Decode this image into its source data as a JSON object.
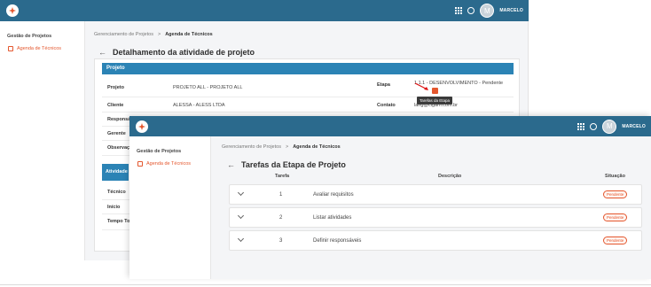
{
  "app": {
    "user_initial": "M",
    "user_name": "MARCELO",
    "brand_color": "#2b6a8d",
    "accent_color": "#e4572e"
  },
  "back": {
    "sidebar": {
      "title": "Gestão de Projetos",
      "item": "Agenda de Técnicos"
    },
    "breadcrumb": [
      "Gerenciamento de Projetos",
      ">",
      "Agenda de Técnicos"
    ],
    "page_title": "Detalhamento da atividade de projeto",
    "section": "Projeto",
    "section2": "Atividade",
    "rows": [
      {
        "label": "Projeto",
        "value": "PROJETO ALL - PROJETO ALL",
        "label2": "Etapa",
        "value2": "1.1.1 - DESENVOLVIMENTO - Pendente"
      },
      {
        "label": "Cliente",
        "value": "ALESSA - ALESS LTDA",
        "label2": "Contato",
        "value2": "lang@cigam.com.br"
      },
      {
        "label": "Responsável"
      },
      {
        "label": "Gerente"
      },
      {
        "label": "Observação"
      }
    ],
    "rows2": [
      {
        "label": "Técnico"
      },
      {
        "label": "Início"
      },
      {
        "label": "Tempo Total"
      }
    ],
    "tooltip": "Tarefas da Etapa"
  },
  "front": {
    "sidebar": {
      "title": "Gestão de Projetos",
      "item": "Agenda de Técnicos"
    },
    "breadcrumb": [
      "Gerenciamento de Projetos",
      ">",
      "Agenda de Técnicos"
    ],
    "page_title": "Tarefas da Etapa de Projeto",
    "columns": {
      "task": "Tarefa",
      "desc": "Descrição",
      "status": "Situação"
    },
    "tasks": [
      {
        "num": "1",
        "desc": "Avaliar requisitos",
        "status": "Pendente"
      },
      {
        "num": "2",
        "desc": "Listar atividades",
        "status": "Pendente"
      },
      {
        "num": "3",
        "desc": "Definir responsáveis",
        "status": "Pendente"
      }
    ]
  }
}
